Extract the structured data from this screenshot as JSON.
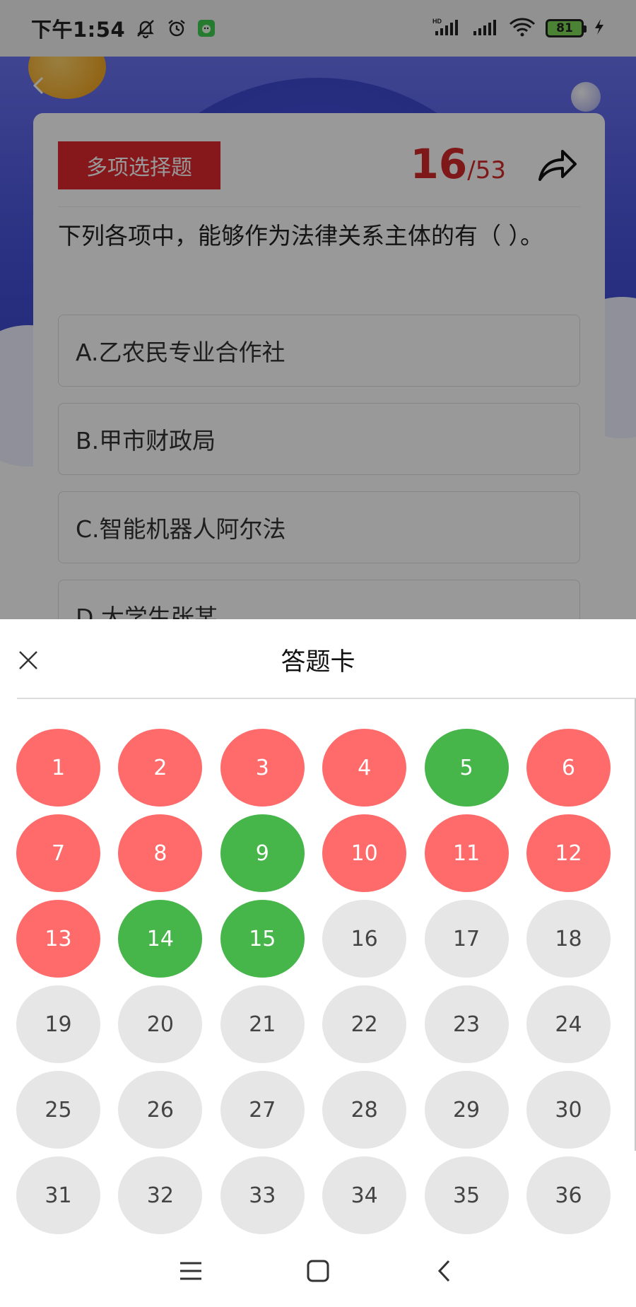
{
  "status_bar": {
    "time": "下午1:54",
    "battery": "81",
    "icons": [
      "bell-off-icon",
      "alarm-icon",
      "app-notification-icon",
      "hd-signal-icon",
      "signal-icon",
      "wifi-icon",
      "battery-icon",
      "charging-icon"
    ]
  },
  "question_page": {
    "type_tag": "多项选择题",
    "progress": {
      "current": "16",
      "separator": "/",
      "total": "53"
    },
    "question": "下列各项中，能够作为法律关系主体的有（ ）。",
    "options": [
      {
        "label": "A.乙农民专业合作社"
      },
      {
        "label": "B.甲市财政局"
      },
      {
        "label": "C.智能机器人阿尔法"
      },
      {
        "label": "D.大学生张某"
      }
    ]
  },
  "answer_sheet": {
    "title": "答题卡",
    "items": [
      {
        "num": "1",
        "status": "wrong"
      },
      {
        "num": "2",
        "status": "wrong"
      },
      {
        "num": "3",
        "status": "wrong"
      },
      {
        "num": "4",
        "status": "wrong"
      },
      {
        "num": "5",
        "status": "right"
      },
      {
        "num": "6",
        "status": "wrong"
      },
      {
        "num": "7",
        "status": "wrong"
      },
      {
        "num": "8",
        "status": "wrong"
      },
      {
        "num": "9",
        "status": "right"
      },
      {
        "num": "10",
        "status": "wrong"
      },
      {
        "num": "11",
        "status": "wrong"
      },
      {
        "num": "12",
        "status": "wrong"
      },
      {
        "num": "13",
        "status": "wrong"
      },
      {
        "num": "14",
        "status": "right"
      },
      {
        "num": "15",
        "status": "right"
      },
      {
        "num": "16",
        "status": "pending"
      },
      {
        "num": "17",
        "status": "pending"
      },
      {
        "num": "18",
        "status": "pending"
      },
      {
        "num": "19",
        "status": "pending"
      },
      {
        "num": "20",
        "status": "pending"
      },
      {
        "num": "21",
        "status": "pending"
      },
      {
        "num": "22",
        "status": "pending"
      },
      {
        "num": "23",
        "status": "pending"
      },
      {
        "num": "24",
        "status": "pending"
      },
      {
        "num": "25",
        "status": "pending"
      },
      {
        "num": "26",
        "status": "pending"
      },
      {
        "num": "27",
        "status": "pending"
      },
      {
        "num": "28",
        "status": "pending"
      },
      {
        "num": "29",
        "status": "pending"
      },
      {
        "num": "30",
        "status": "pending"
      },
      {
        "num": "31",
        "status": "pending"
      },
      {
        "num": "32",
        "status": "pending"
      },
      {
        "num": "33",
        "status": "pending"
      },
      {
        "num": "34",
        "status": "pending"
      },
      {
        "num": "35",
        "status": "pending"
      },
      {
        "num": "36",
        "status": "pending"
      }
    ]
  },
  "colors": {
    "wrong": "#ff6b6b",
    "right": "#46b54a",
    "pending": "#e6e6e6",
    "accent": "#e0292e"
  },
  "nav_bar": {
    "icons": [
      "menu-icon",
      "home-square-icon",
      "back-chevron-icon"
    ]
  }
}
